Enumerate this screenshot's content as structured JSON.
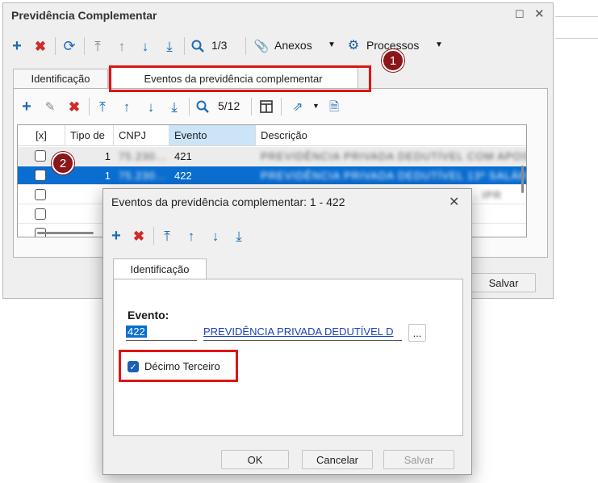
{
  "main_window": {
    "title": "Previdência Complementar",
    "toolbar": {
      "record_counter": "1/3",
      "attachments_label": "Anexos",
      "processes_label": "Processos"
    },
    "tabs": [
      "Identificação",
      "Eventos da previdência complementar"
    ],
    "inner_toolbar": {
      "record_counter": "5/12"
    },
    "grid": {
      "columns": [
        "[x]",
        "Tipo de",
        "CNPJ",
        "Evento",
        "Descrição"
      ],
      "rows": [
        {
          "tipo": "1",
          "cnpj": "75.230...",
          "evento": "421",
          "descricao": "PREVIDÊNCIA PRIVADA DEDUTÍVEL COM APOS",
          "selected": false
        },
        {
          "tipo": "1",
          "cnpj": "75.230...",
          "evento": "422",
          "descricao": "PREVIDÊNCIA PRIVADA DEDUTÍVEL 13º SALÁR",
          "selected": true
        },
        {
          "tipo": "",
          "cnpj": "",
          "evento": "",
          "descricao": ". IPR",
          "selected": false
        },
        {
          "tipo": "",
          "cnpj": "",
          "evento": "",
          "descricao": "",
          "selected": false
        },
        {
          "tipo": "",
          "cnpj": "",
          "evento": "",
          "descricao": "",
          "selected": false
        }
      ]
    },
    "save_button": "Salvar"
  },
  "dialog": {
    "title": "Eventos da previdência complementar: 1 - 422",
    "tab": "Identificação",
    "event_label": "Evento:",
    "event_code": "422",
    "event_description": "PREVIDÊNCIA PRIVADA DEDUTÍVEL D",
    "browse_label": "...",
    "checkbox_label": "Décimo Terceiro",
    "checkbox_checked": true,
    "buttons": {
      "ok": "OK",
      "cancel": "Cancelar",
      "save": "Salvar"
    }
  },
  "badges": [
    "1",
    "2"
  ],
  "colors": {
    "accent": "#1a6bb5",
    "selection": "#0a6ed1",
    "highlight_border": "#e01414",
    "badge": "#8b1518"
  }
}
